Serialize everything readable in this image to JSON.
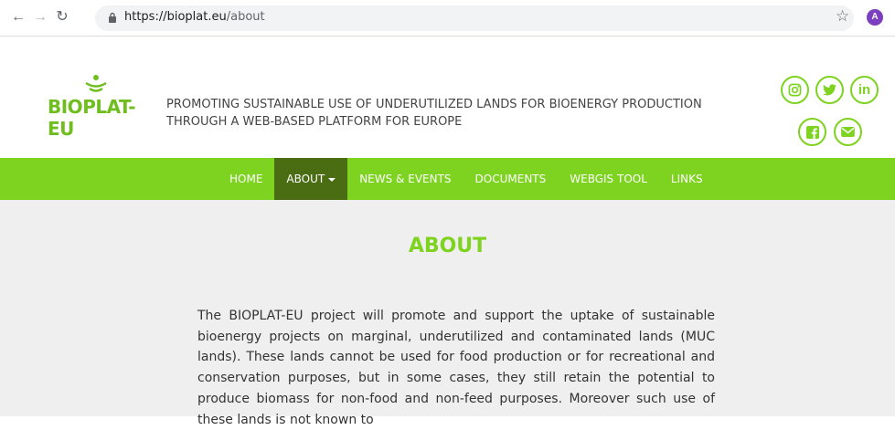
{
  "browser": {
    "url_host": "https://bioplat.eu",
    "url_path": "/about",
    "profile_initial": "A"
  },
  "header": {
    "logo_text": "BIOPLAT-EU",
    "tagline": "PROMOTING SUSTAINABLE USE OF UNDERUTILIZED LANDS FOR BIOENERGY PRODUCTION THROUGH A WEB-BASED PLATFORM FOR EUROPE",
    "social": [
      "instagram-icon",
      "twitter-icon",
      "linkedin-icon",
      "facebook-icon",
      "email-icon"
    ]
  },
  "menu": {
    "items": [
      "HOME",
      "ABOUT",
      "NEWS & EVENTS",
      "DOCUMENTS",
      "WEBGIS TOOL",
      "LINKS"
    ],
    "active": "ABOUT"
  },
  "main": {
    "title": "ABOUT",
    "paragraph": "The BIOPLAT-EU project will promote and support the uptake of sustainable bioenergy projects on marginal, underutilized and contaminated lands (MUC lands). These lands cannot be used for food production or for recreational and conservation purposes, but in some cases, they still retain the potential to produce biomass for non-food and non-feed purposes. Moreover such use of these lands is not known to"
  },
  "colors": {
    "brand_green": "#7ed321",
    "active_menu": "#4a6d14",
    "content_bg": "#efefef"
  }
}
